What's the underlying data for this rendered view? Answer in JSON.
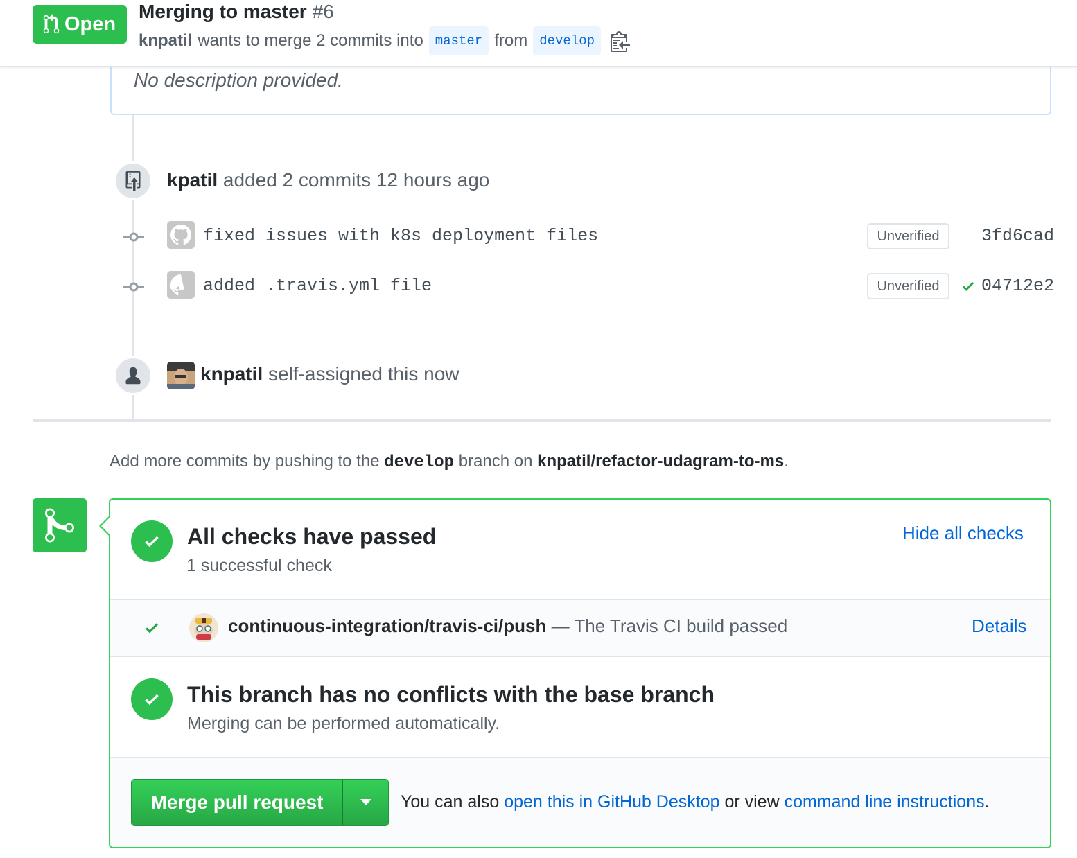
{
  "header": {
    "state_label": "Open",
    "title": "Merging to master",
    "number": "#6",
    "author": "knpatil",
    "merge_text": "wants to merge 2 commits into",
    "base_branch": "master",
    "from_text": "from",
    "head_branch": "develop"
  },
  "description": {
    "text": "No description provided."
  },
  "timeline": {
    "commits_event": {
      "user": "kpatil",
      "text": "added 2 commits 12 hours ago"
    },
    "commits": [
      {
        "message": "fixed issues with k8s deployment files",
        "badge": "Unverified",
        "sha": "3fd6cad"
      },
      {
        "message": "added .travis.yml file",
        "badge": "Unverified",
        "sha": "04712e2"
      }
    ],
    "assign_event": {
      "user": "knpatil",
      "text": "self-assigned this now"
    }
  },
  "push_hint": {
    "prefix": "Add more commits by pushing to the",
    "branch": "develop",
    "middle": "branch on",
    "repo": "knpatil/refactor-udagram-to-ms",
    "suffix": "."
  },
  "merge_box": {
    "checks_title": "All checks have passed",
    "checks_sub": "1 successful check",
    "hide_checks": "Hide all checks",
    "check": {
      "name": "continuous-integration/travis-ci/push",
      "description": "— The Travis CI build passed",
      "details": "Details"
    },
    "conflicts_title": "This branch has no conflicts with the base branch",
    "conflicts_sub": "Merging can be performed automatically.",
    "merge_button": "Merge pull request",
    "alt_prefix": "You can also",
    "alt_link1": "open this in GitHub Desktop",
    "alt_middle": "or view",
    "alt_link2": "command line instructions",
    "alt_suffix": "."
  },
  "colors": {
    "green": "#2cbe4e",
    "link": "#0366d6",
    "branch_bg": "#eaf5ff"
  },
  "icons": [
    "git-pull-request-icon",
    "clipboard-icon",
    "repo-push-icon",
    "git-commit-icon",
    "github-avatar-icon",
    "check-icon",
    "person-icon",
    "git-merge-icon",
    "triangle-down-icon"
  ]
}
